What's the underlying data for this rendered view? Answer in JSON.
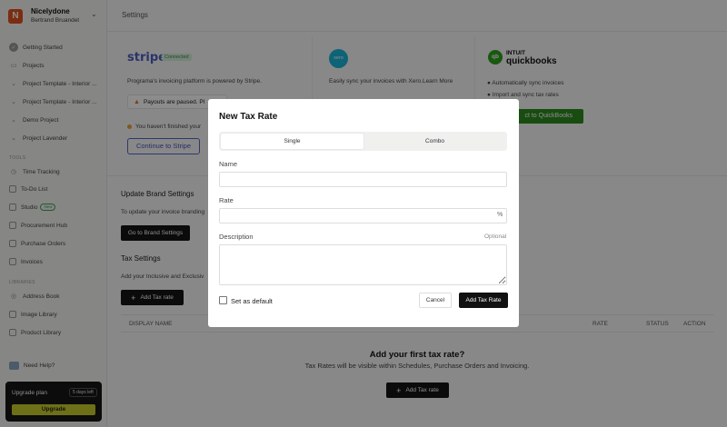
{
  "workspace": {
    "logo": "N",
    "name": "Nicelydone",
    "user": "Bertrand Bruandet"
  },
  "sidebar": {
    "items": [
      {
        "label": "Getting Started",
        "icon": "check-circle-icon"
      },
      {
        "label": "Projects",
        "icon": "folder-icon"
      },
      {
        "label": "Project Template - Interior ...",
        "icon": "chevron-down-icon"
      },
      {
        "label": "Project Template - Interior ...",
        "icon": "chevron-down-icon"
      },
      {
        "label": "Demo Project",
        "icon": "chevron-down-icon"
      },
      {
        "label": "Project Lavender",
        "icon": "chevron-down-icon"
      }
    ],
    "tools_label": "TOOLS",
    "tools": [
      {
        "label": "Time Tracking",
        "icon": "clock-icon"
      },
      {
        "label": "To-Do List",
        "icon": "checklist-icon"
      },
      {
        "label": "Studio",
        "badge": "New",
        "icon": "studio-icon"
      },
      {
        "label": "Procurement Hub",
        "icon": "hub-icon"
      },
      {
        "label": "Purchase Orders",
        "icon": "document-icon"
      },
      {
        "label": "Invoices",
        "icon": "invoice-icon"
      }
    ],
    "libraries_label": "LIBRARIES",
    "libraries": [
      {
        "label": "Address Book",
        "icon": "address-book-icon"
      },
      {
        "label": "Image Library",
        "icon": "image-icon"
      },
      {
        "label": "Product Library",
        "icon": "product-icon"
      }
    ],
    "help": "Need Help?",
    "upgrade": {
      "title": "Upgrade plan",
      "days": "5 days left",
      "button": "Upgrade"
    }
  },
  "main": {
    "title": "Settings",
    "stripe": {
      "logo": "stripe",
      "status": "Connected",
      "text": "Programa's invoicing platform is powered by Stripe.",
      "alert": "Payouts are paused. Pl",
      "notice": "You haven't finished your",
      "button": "Continue to Stripe"
    },
    "xero": {
      "logo": "xero",
      "text": "Easily sync your invoices with Xero.Learn More"
    },
    "quickbooks": {
      "intuit": "INTUIT",
      "name": "quickbooks",
      "bullets": [
        "Automatically sync invoices",
        "Import and sync tax rates"
      ],
      "button": "ct to QuickBooks"
    },
    "brand": {
      "title": "Update Brand Settings",
      "text": "To update your invoice branding",
      "button": "Go to Brand Settings"
    },
    "tax": {
      "title": "Tax Settings",
      "text": "Add your Inclusive and Exclusiv",
      "button": "Add Tax rate",
      "columns": [
        "DISPLAY NAME",
        "RATE",
        "STATUS",
        "ACTION"
      ],
      "empty_title": "Add your first tax rate?",
      "empty_text": "Tax Rates will be visible within Schedules, Purchase Orders and Invoicing.",
      "empty_button": "Add Tax rate"
    }
  },
  "modal": {
    "title": "New Tax Rate",
    "tabs": [
      "Single",
      "Combo"
    ],
    "name_label": "Name",
    "rate_label": "Rate",
    "rate_suffix": "%",
    "description_label": "Description",
    "optional": "Optional",
    "default_label": "Set as default",
    "cancel": "Cancel",
    "submit": "Add Tax Rate"
  }
}
